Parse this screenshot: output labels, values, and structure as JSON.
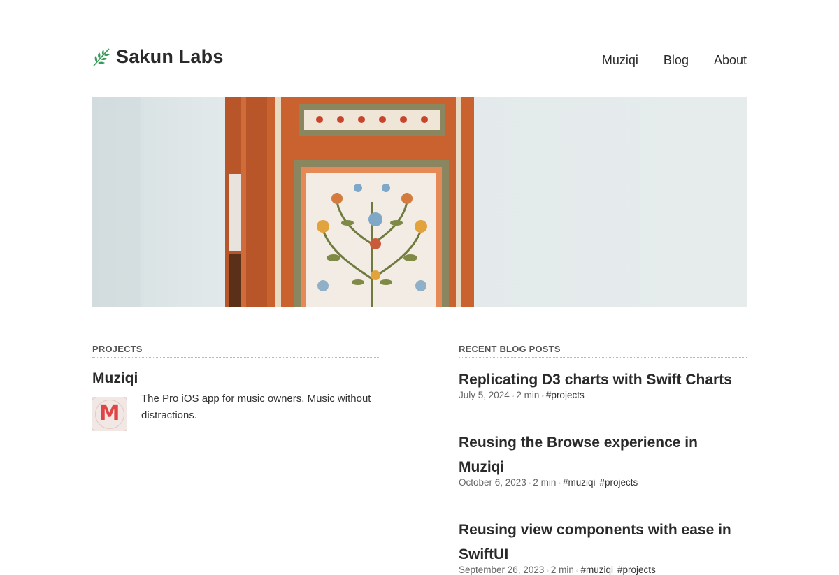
{
  "header": {
    "brand_name": "Sakun Labs",
    "brand_icon": "sprig-icon",
    "nav": [
      "Muziqi",
      "Blog",
      "About"
    ]
  },
  "hero": {
    "image": "ornate-painted-door-photo"
  },
  "projects": {
    "section_title": "PROJECTS",
    "items": [
      {
        "title": "Muziqi",
        "icon_letter": "M",
        "description": "The Pro iOS app for music owners. Music without distractions."
      }
    ]
  },
  "blog": {
    "section_title": "RECENT BLOG POSTS",
    "posts": [
      {
        "title": "Replicating D3 charts with Swift Charts",
        "date": "July 5, 2024",
        "read_time": "2 min",
        "tags": [
          "#projects"
        ]
      },
      {
        "title": "Reusing the Browse experience in Muziqi",
        "date": "October 6, 2023",
        "read_time": "2 min",
        "tags": [
          "#muziqi",
          "#projects"
        ]
      },
      {
        "title": "Reusing view components with ease in SwiftUI",
        "date": "September 26, 2023",
        "read_time": "2 min",
        "tags": [
          "#muziqi",
          "#projects"
        ]
      }
    ]
  },
  "colors": {
    "accent_red": "#e04545",
    "leaf_green": "#3a9a5a",
    "text": "#2a2a2a"
  }
}
